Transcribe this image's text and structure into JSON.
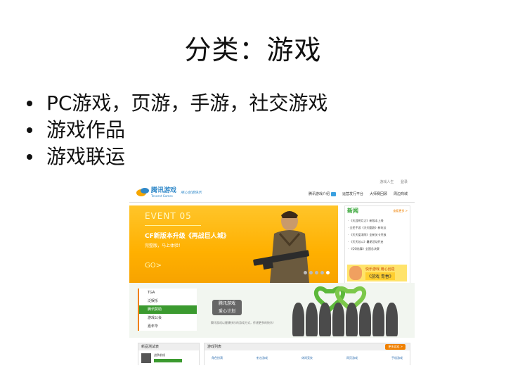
{
  "slide": {
    "title": "分类：游戏",
    "bullets": [
      "PC游戏，页游，手游，社交游戏",
      "游戏作品",
      "游戏联运"
    ]
  },
  "site": {
    "topbar": [
      "游戏人生",
      "登录"
    ],
    "logo_cn": "腾讯游戏",
    "logo_en": "Tencent Games",
    "slogan": "用心创造快乐",
    "nav": [
      "腾讯游戏介绍",
      "运营发行平台",
      "大师赛回顾",
      "周边商城"
    ],
    "banner": {
      "event": "EVENT 05",
      "headline": "CF新版本升级《再战巨人城》",
      "sub": "完整版，马上体验！",
      "go": "GO>"
    },
    "news": {
      "title": "新闻",
      "more": "查看更多 >",
      "items": [
        "· 《天涯明月刀》新版本上线",
        "· 全民手游《天天酷跑》新玩法",
        "· 《天天爱消除》全新关卡开放",
        "· 《天天炫斗》暑期活动开启",
        "· 《QQ炫舞》全国总决赛"
      ],
      "promo_line1": "快乐游戏 用心创造",
      "promo_line2": "《游戏 青春》"
    },
    "side_menu": [
      "TGA",
      "泛娱乐",
      "腾讯赞助",
      "游戏公会",
      "嘉年华"
    ],
    "side_selected_index": 2,
    "mid_badge": [
      "腾讯游戏",
      "爱心计划"
    ],
    "mid_text": "腾讯游戏以健康快乐的游戏方式，传递更多的快乐！",
    "box1": {
      "title": "新品测试表",
      "name": "战争前线",
      "bar_level": 0.5
    },
    "box2": {
      "title": "游戏列表",
      "button": "更多游戏 >",
      "columns": [
        "角色扮演",
        "射击游戏",
        "休闲竞技",
        "网页游戏",
        "手机游戏"
      ]
    },
    "colors": {
      "orange": "#ffb000",
      "green": "#3b9a2f",
      "blue": "#2f88c9"
    }
  }
}
